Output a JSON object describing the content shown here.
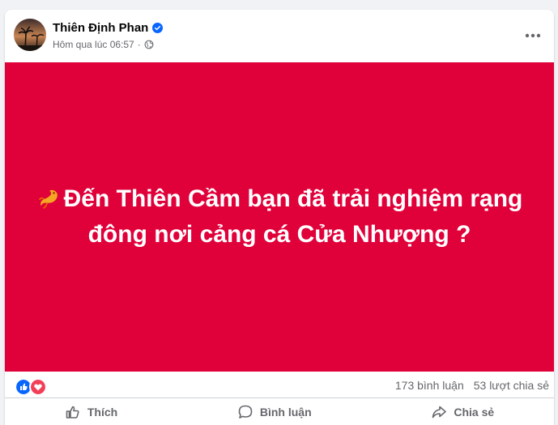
{
  "post": {
    "author": "Thiên Định Phan",
    "timestamp": "Hôm qua lúc 06:57",
    "separator": "·",
    "privacy_icon": "globe-icon",
    "verified_icon": "verified-badge-icon",
    "more_icon": "more-options-icon"
  },
  "media": {
    "background_color": "#e0003a",
    "emoji": "dragon-emoji",
    "text": "Đến Thiên Cầm bạn đã trải nghiệm rạng đông nơi cảng cá Cửa Nhượng ?"
  },
  "stats": {
    "reactions": [
      "like",
      "love"
    ],
    "comments": "173 bình luận",
    "shares": "53 lượt chia sẻ"
  },
  "actions": {
    "like_label": "Thích",
    "comment_label": "Bình luận",
    "share_label": "Chia sẻ"
  },
  "colors": {
    "accent": "#0866ff",
    "love": "#f33e58",
    "secondary_text": "#65676b"
  }
}
